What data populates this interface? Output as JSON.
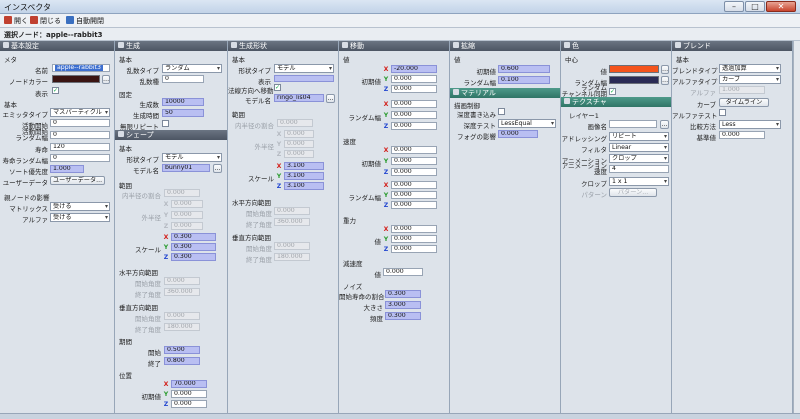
{
  "window": {
    "title": "インスペクタ"
  },
  "toolbar": {
    "open": "開く",
    "close": "閉じる",
    "autoopen": "自動開閉"
  },
  "node": {
    "label": "選択ノード：apple--rabbit3"
  },
  "colors": {
    "header": "#56606d",
    "num_bg": "#b9bff2",
    "color_primary": "#f4541c",
    "color_random": "#2a2b55",
    "node_color": "#3a1412"
  },
  "c1": {
    "header": "基本設定",
    "meta": "メタ",
    "name_l": "名前",
    "name_v": "apple--rabbit3",
    "nodecolor_l": "ノードカラー",
    "show_l": "表示",
    "basic": "基本",
    "emitter_l": "エミッタタイプ",
    "emitter_v": "マスパーティクル",
    "act_l": "活動開始",
    "act_v": "0",
    "act_rand_l": "活動開始\nランダム幅",
    "act_rand_v": "0",
    "life_l": "寿命",
    "life_v": "120",
    "life_rand_l": "寿命ランダム幅",
    "life_rand_v": "0",
    "sort_l": "ソート優先度",
    "sort_v": "1.000",
    "userdata_l": "ユーザーデータ",
    "userdata_btn": "ユーザーデータ...",
    "parent": "親ノードの影響",
    "matrix_l": "マトリックス",
    "matrix_v": "受ける",
    "alpha_l": "アルファ",
    "alpha_v": "受ける"
  },
  "c2": {
    "header": "生成",
    "basic": "基本",
    "randtype_l": "乱数タイプ",
    "randtype_v": "ランダム",
    "seed_l": "乱数種",
    "seed_v": "0",
    "fixed": "固定",
    "count_l": "生成数",
    "count_v": "10000",
    "time_l": "生成時間",
    "time_v": "50",
    "inf_l": "無限リピート",
    "shape_header": "シェープ",
    "basic2": "基本",
    "shapetype_l": "形状タイプ",
    "shapetype_v": "モデル",
    "model_l": "モデル名",
    "model_v": "bunny01",
    "range": "範囲",
    "inner_l": "内半径の割合",
    "inner_v": "0.000",
    "outer_l": "外半径",
    "x": "X",
    "y": "Y",
    "z": "Z",
    "ov_x": "0.000",
    "ov_y": "0.000",
    "ov_z": "0.000",
    "scale_l": "スケール",
    "sc_x": "0.300",
    "sc_y": "0.300",
    "sc_z": "0.300",
    "hrange": "水平方向範囲",
    "hstart_l": "開始角度",
    "hstart_v": "0.000",
    "hend_l": "終了角度",
    "hend_v": "360.000",
    "vrange": "垂直方向範囲",
    "vstart_l": "開始角度",
    "vstart_v": "0.000",
    "vend_l": "終了角度",
    "vend_v": "180.000",
    "period": "期間",
    "pstart_l": "開始",
    "pstart_v": "0.500",
    "pend_l": "終了",
    "pend_v": "0.800",
    "pos": "位置",
    "pos_l": "初期値",
    "pos_x": "70.000",
    "pos_y": "0.000",
    "pos_z": "0.000"
  },
  "c3": {
    "header": "生成形状",
    "basic": "基本",
    "shapetype_l": "形状タイプ",
    "shapetype_v": "モデル",
    "show_l": "表示",
    "normal_l": "法線方向へ移動",
    "model_l": "モデル名",
    "model_v": "ringo_lis04",
    "range": "範囲",
    "inner_l": "内半径の割合",
    "inner_v": "0.000",
    "outer_l": "外半径",
    "x": "X",
    "y": "Y",
    "z": "Z",
    "ov_x": "0.000",
    "ov_y": "0.000",
    "ov_z": "0.000",
    "scale_l": "スケール",
    "sc_x": "3.100",
    "sc_y": "3.100",
    "sc_z": "3.100",
    "hrange": "水平方向範囲",
    "hstart_l": "開始角度",
    "hstart_v": "0.000",
    "hend_l": "終了角度",
    "hend_v": "360.000",
    "vrange": "垂直方向範囲",
    "vstart_l": "開始角度",
    "vstart_v": "0.000",
    "vend_l": "終了角度",
    "vend_v": "180.000"
  },
  "c4": {
    "header": "移動",
    "x": "X",
    "y": "Y",
    "z": "Z",
    "value": "値",
    "init_l": "初期値",
    "iv_x": "-20.000",
    "iv_y": "0.000",
    "iv_z": "0.000",
    "rand_l": "ランダム幅",
    "rv_x": "0.000",
    "rv_y": "0.000",
    "rv_z": "0.000",
    "speed": "速度",
    "sinit_l": "初期値",
    "si_x": "0.000",
    "si_y": "0.000",
    "si_z": "0.000",
    "srand_l": "ランダム幅",
    "sr_x": "0.000",
    "sr_y": "0.000",
    "sr_z": "0.000",
    "gravity": "重力",
    "g_l": "値",
    "g_x": "0.000",
    "g_y": "0.000",
    "g_z": "0.000",
    "damp": "減速度",
    "d_l": "値",
    "d_v": "0.000",
    "noise": "ノイズ",
    "nstart_l": "開始寿命の割合",
    "nstart_v": "0.300",
    "nsize_l": "大きさ",
    "nsize_v": "3.000",
    "nfreq_l": "頻度",
    "nfreq_v": "0.300"
  },
  "c5": {
    "header": "拡縮",
    "value": "値",
    "init_l": "初期値",
    "init_v": "0.600",
    "rand_l": "ランダム幅",
    "rand_v": "0.100",
    "mat_header": "マテリアル",
    "draw": "描画制御",
    "zwrite_l": "深度書き込み",
    "ztest_l": "深度テスト",
    "ztest_v": "LessEqual",
    "fog_l": "フォグの影響",
    "fog_v": "0.000"
  },
  "c6": {
    "header": "色",
    "center": "中心",
    "value_l": "値",
    "rand_l": "ランダム幅",
    "chan_l": "ランダム\nチャンネル同期",
    "tex_header": "テクスチャ",
    "layer": "レイヤー1",
    "img_l": "画像名",
    "addr_l": "アドレッシング",
    "addr_v": "リピート",
    "filter_l": "フィルタ",
    "filter_v": "Linear",
    "anim_l": "アニメーション",
    "anim_v": "クロップ",
    "animspd_l": "アニメーション\n速度",
    "animspd_v": "4",
    "crop_l": "クロップ",
    "crop_v": "1 x 1",
    "pattern_l": "パターン",
    "pattern_btn": "パターン..."
  },
  "c7": {
    "header": "ブレンド",
    "basic": "基本",
    "blend_l": "ブレンドタイプ",
    "blend_v": "透過加算",
    "atype_l": "アルファタイプ",
    "atype_v": "カーブ",
    "alpha_l": "アルファ",
    "alpha_v": "1.000",
    "curve_l": "カーブ",
    "curve_btn": "タイムライン",
    "atest_l": "アルファテスト",
    "cmp_l": "比較方法",
    "cmp_v": "Less",
    "ref_l": "基準値",
    "ref_v": "0.000"
  }
}
